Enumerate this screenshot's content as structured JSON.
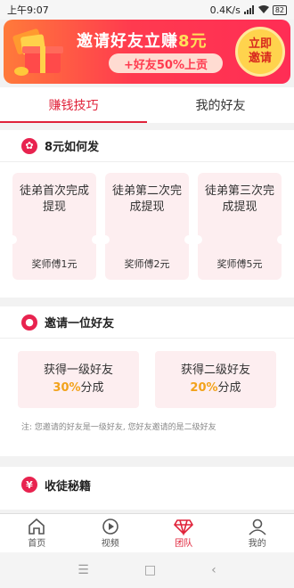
{
  "status": {
    "time": "上午9:07",
    "speed": "0.4K/s",
    "battery": "82"
  },
  "banner": {
    "title_main": "邀请好友立赚",
    "title_highlight": "8元",
    "subtitle": "+好友50%上贡",
    "button_line1": "立即",
    "button_line2": "邀请"
  },
  "tabs": [
    {
      "label": "赚钱技巧"
    },
    {
      "label": "我的好友"
    }
  ],
  "section1": {
    "title": "8元如何发",
    "tickets": [
      {
        "task": "徒弟首次完成提现",
        "reward": "奖师傅1元"
      },
      {
        "task": "徒弟第二次完成提现",
        "reward": "奖师傅2元"
      },
      {
        "task": "徒弟第三次完成提现",
        "reward": "奖师傅5元"
      }
    ]
  },
  "section2": {
    "title": "邀请一位好友",
    "cards": [
      {
        "line": "获得一级好友",
        "percent": "30%",
        "suffix": "分成"
      },
      {
        "line": "获得二级好友",
        "percent": "20%",
        "suffix": "分成"
      }
    ],
    "note": "注:   您邀请的好友是一级好友,     您好友邀请的是二级好友"
  },
  "section3": {
    "title": "收徒秘籍"
  },
  "tabbar": [
    {
      "label": "首页",
      "icon": "home-icon"
    },
    {
      "label": "视频",
      "icon": "play-icon"
    },
    {
      "label": "团队",
      "icon": "diamond-icon"
    },
    {
      "label": "我的",
      "icon": "user-icon"
    }
  ],
  "colors": {
    "accent": "#e0233a",
    "banner_gold": "#ffd34d",
    "ticket_bg": "#fdeef0",
    "percent": "#f2a21b"
  }
}
